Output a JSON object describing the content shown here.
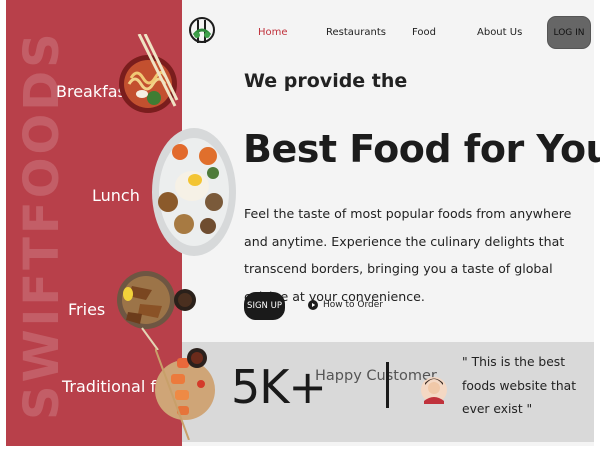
{
  "sidebar": {
    "brand_watermark": "SWIFTFOODS",
    "categories": [
      {
        "label": "Breakfast"
      },
      {
        "label": "Lunch"
      },
      {
        "label": "Fries"
      },
      {
        "label": "Traditional foods"
      }
    ]
  },
  "nav": {
    "links": [
      {
        "label": "Home"
      },
      {
        "label": "Restaurants"
      },
      {
        "label": "Food"
      },
      {
        "label": "About Us"
      }
    ],
    "active_link": "Home",
    "login_label": "LOG IN"
  },
  "hero": {
    "subtitle": "We provide the",
    "title": "Best Food for You",
    "description": "Feel the taste of most popular foods from anywhere and anytime. Experience the culinary delights that transcend borders, bringing you a taste of global cuisine at your convenience.",
    "signup_label": "SIGN UP",
    "how_to_label": "How to Order"
  },
  "stats": {
    "count": "5K+",
    "label": "Happy Customer",
    "testimonial": "\" This is the best foods website that ever exist \""
  },
  "colors": {
    "sidebar": "#b8404a",
    "active_nav": "#c0323c",
    "main_background": "#f4f4f4",
    "stats_background": "#d9d9d9",
    "login_button": "#666666",
    "signup_button": "#1a1a1a"
  }
}
